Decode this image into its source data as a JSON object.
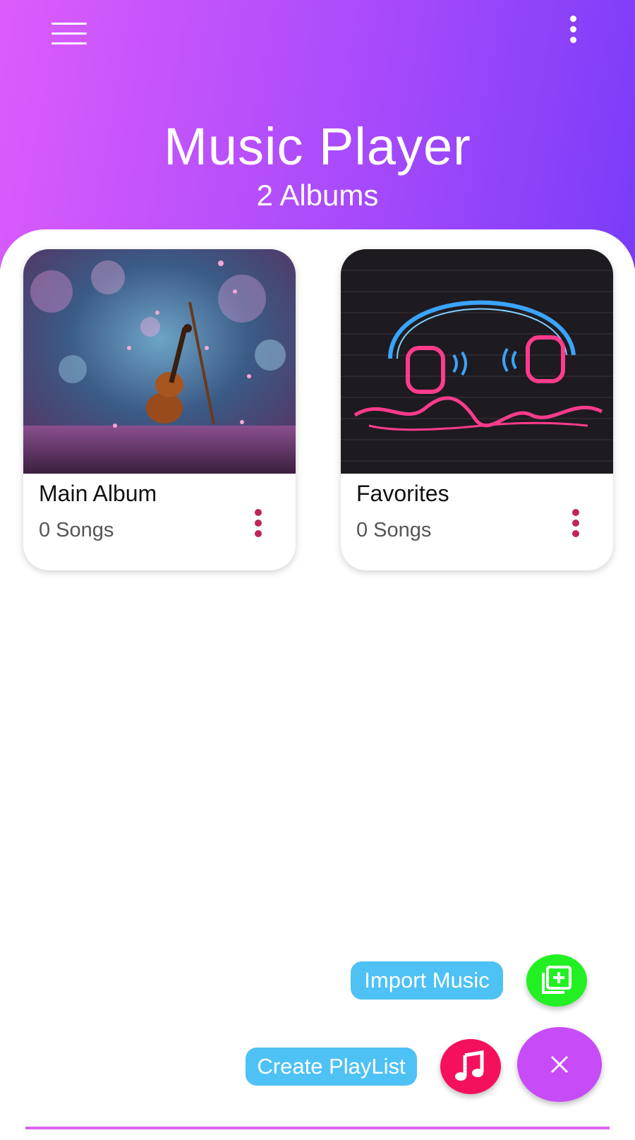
{
  "header": {
    "title": "Music Player",
    "subtitle": "2 Albums",
    "menu_icon": "hamburger-menu-icon",
    "more_icon": "more-vertical-icon"
  },
  "albums": [
    {
      "name": "Main Album",
      "songs": "0 Songs",
      "cover": "violin-photo"
    },
    {
      "name": "Favorites",
      "songs": "0 Songs",
      "cover": "neon-headphones-photo"
    }
  ],
  "actions": {
    "import_label": "Import Music",
    "create_label": "Create PlayList",
    "import_icon": "add-library-icon",
    "create_icon": "music-note-icon",
    "close_icon": "close-icon"
  },
  "colors": {
    "header_gradient_start": "#dd5cfb",
    "header_gradient_end": "#7a3cf8",
    "pill": "#4ec1f5",
    "import_fab": "#22f022",
    "create_fab": "#f5105e",
    "main_fab": "#c84bf8",
    "kebab": "#c0245c"
  }
}
